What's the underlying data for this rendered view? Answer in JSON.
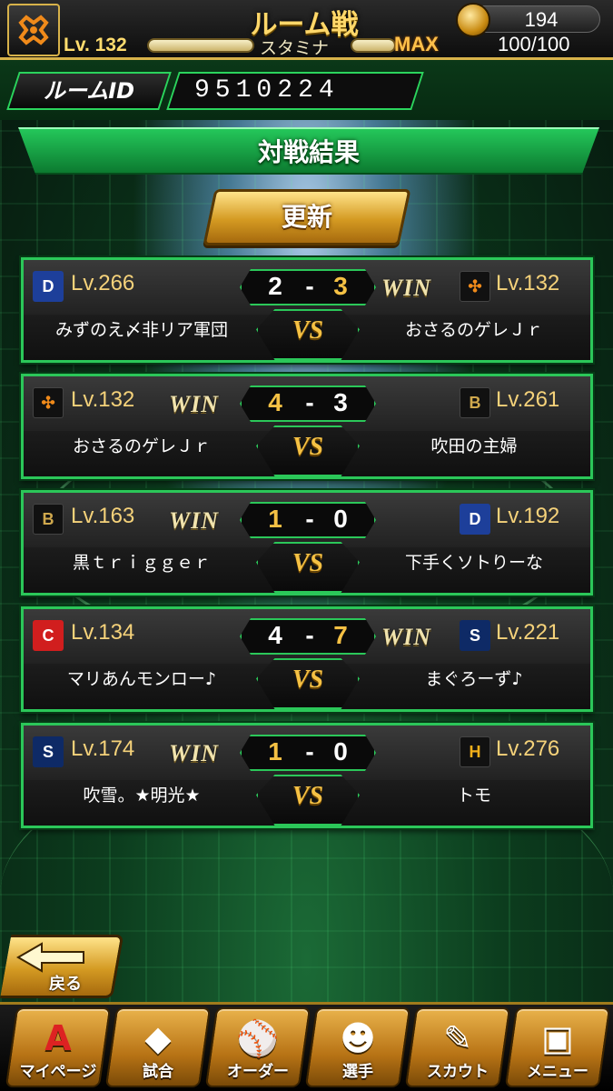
{
  "header": {
    "title": "ルーム戦",
    "coins": "194",
    "level": "Lv. 132",
    "stamina_label": "スタミナ",
    "stamina_max": "MAX",
    "stamina_value": "100/100"
  },
  "room": {
    "label": "ルームID",
    "id": "9510224"
  },
  "section_title": "対戦結果",
  "refresh_label": "更新",
  "matches": [
    {
      "left": {
        "team_icon": "dragons-icon",
        "level": "Lv.266",
        "name": "みずのえ〆非リア軍団",
        "score": "2"
      },
      "right": {
        "team_icon": "giants-icon",
        "level": "Lv.132",
        "name": "おさるのゲレＪｒ",
        "score": "3"
      },
      "winner": "right"
    },
    {
      "left": {
        "team_icon": "giants-icon",
        "level": "Lv.132",
        "name": "おさるのゲレＪｒ",
        "score": "4"
      },
      "right": {
        "team_icon": "buffaloes-icon",
        "level": "Lv.261",
        "name": "吹田の主婦",
        "score": "3"
      },
      "winner": "left"
    },
    {
      "left": {
        "team_icon": "buffaloes-icon",
        "level": "Lv.163",
        "name": "黒ｔｒｉｇｇｅｒ",
        "score": "1"
      },
      "right": {
        "team_icon": "dragons-icon",
        "level": "Lv.192",
        "name": "下手くソトりーな",
        "score": "0"
      },
      "winner": "left"
    },
    {
      "left": {
        "team_icon": "carp-icon",
        "level": "Lv.134",
        "name": "マリあんモンロー♪",
        "score": "4"
      },
      "right": {
        "team_icon": "swallows-icon",
        "level": "Lv.221",
        "name": "まぐろーず♪",
        "score": "7"
      },
      "winner": "right"
    },
    {
      "left": {
        "team_icon": "swallows-icon",
        "level": "Lv.174",
        "name": "吹雪。★明光★",
        "score": "1"
      },
      "right": {
        "team_icon": "hawks-icon",
        "level": "Lv.276",
        "name": "トモ",
        "score": "0"
      },
      "winner": "left"
    }
  ],
  "win_label": "WIN",
  "vs_label": "VS",
  "score_dash": "-",
  "back_label": "戻る",
  "nav": [
    {
      "label": "マイページ",
      "icon": "mypage-icon"
    },
    {
      "label": "試合",
      "icon": "match-icon"
    },
    {
      "label": "オーダー",
      "icon": "order-icon"
    },
    {
      "label": "選手",
      "icon": "players-icon"
    },
    {
      "label": "スカウト",
      "icon": "scout-icon"
    },
    {
      "label": "メニュー",
      "icon": "menu-icon"
    }
  ],
  "colors": {
    "accent_green": "#2bc759",
    "gold": "#f5c144",
    "level_text": "#f5d27a"
  }
}
